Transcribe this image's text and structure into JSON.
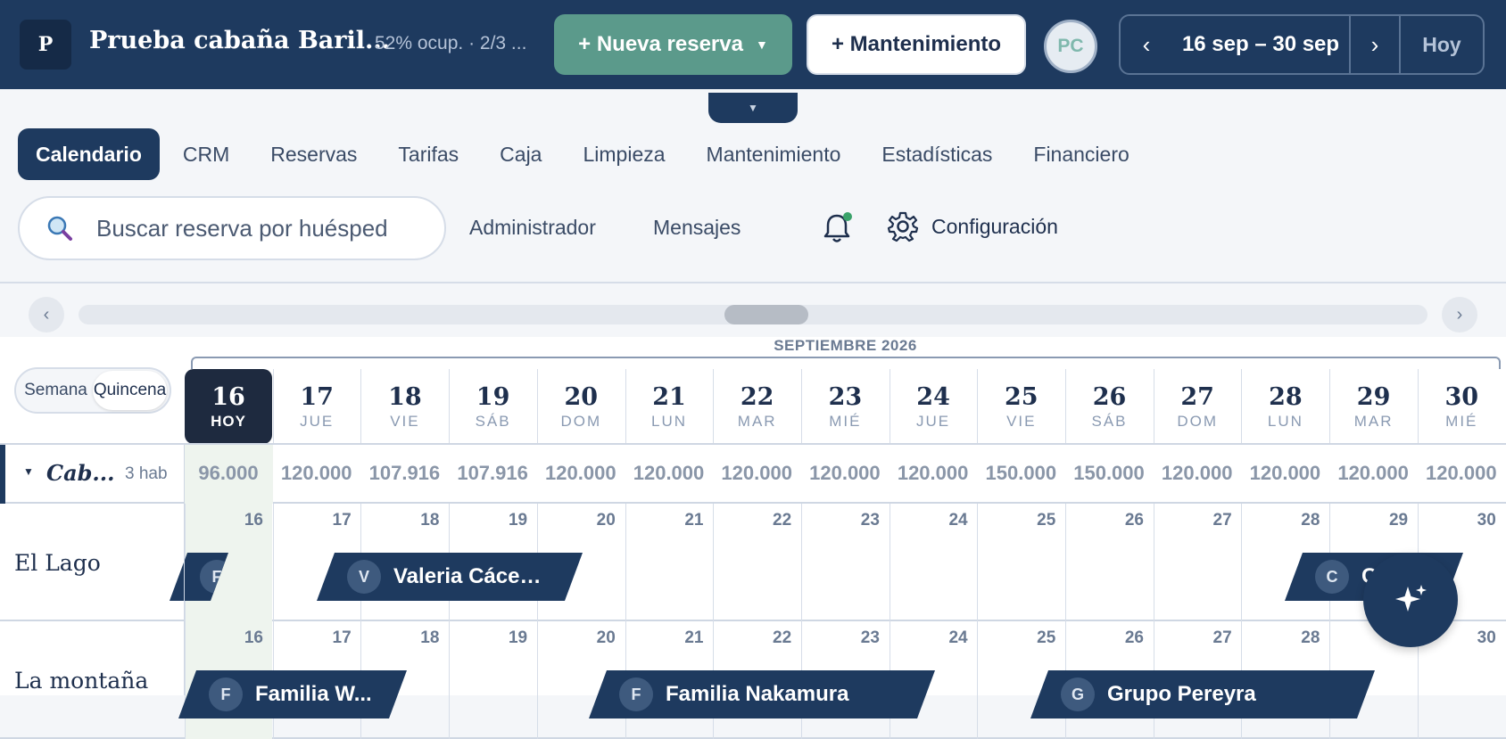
{
  "header": {
    "logo_letter": "P",
    "property_title": "Prueba cabaña Baril...",
    "occupancy": "52% ocup. · 2/3 ...",
    "new_booking_label": "+ Nueva reserva",
    "maintenance_label": "+ Mantenimiento",
    "avatar_initials": "PC",
    "date_range": "16 sep – 30 sep",
    "today_label": "Hoy",
    "prev_icon": "chevron-left-icon",
    "next_icon": "chevron-right-icon"
  },
  "nav": {
    "items": [
      {
        "label": "Calendario",
        "active": true
      },
      {
        "label": "CRM"
      },
      {
        "label": "Reservas"
      },
      {
        "label": "Tarifas"
      },
      {
        "label": "Caja"
      },
      {
        "label": "Limpieza"
      },
      {
        "label": "Mantenimiento"
      },
      {
        "label": "Estadísticas"
      },
      {
        "label": "Financiero"
      }
    ]
  },
  "toolbar": {
    "search_placeholder": "Buscar reserva por huésped",
    "admin_label": "Administrador",
    "messages_label": "Mensajes",
    "config_label": "Configuración"
  },
  "calendar": {
    "month_label": "SEPTIEMBRE 2026",
    "view_options": [
      "Semana",
      "Quincena"
    ],
    "selected_view": "Quincena",
    "days": [
      {
        "num": "16",
        "dow": "HOY",
        "today": true
      },
      {
        "num": "17",
        "dow": "JUE"
      },
      {
        "num": "18",
        "dow": "VIE"
      },
      {
        "num": "19",
        "dow": "SÁB"
      },
      {
        "num": "20",
        "dow": "DOM"
      },
      {
        "num": "21",
        "dow": "LUN"
      },
      {
        "num": "22",
        "dow": "MAR"
      },
      {
        "num": "23",
        "dow": "MIÉ"
      },
      {
        "num": "24",
        "dow": "JUE"
      },
      {
        "num": "25",
        "dow": "VIE"
      },
      {
        "num": "26",
        "dow": "SÁB"
      },
      {
        "num": "27",
        "dow": "DOM"
      },
      {
        "num": "28",
        "dow": "LUN"
      },
      {
        "num": "29",
        "dow": "MAR"
      },
      {
        "num": "30",
        "dow": "MIÉ"
      }
    ],
    "group": {
      "name": "Cab...",
      "count": "3 hab",
      "rates": [
        "96.000",
        "120.000",
        "107.916",
        "107.916",
        "120.000",
        "120.000",
        "120.000",
        "120.000",
        "120.000",
        "150.000",
        "150.000",
        "120.000",
        "120.000",
        "120.000",
        "120.000"
      ]
    },
    "rooms": [
      {
        "name": "El Lago",
        "bookings": [
          {
            "initial": "F",
            "label": ""
          },
          {
            "initial": "V",
            "label": "Valeria Cáce…"
          },
          {
            "initial": "C",
            "label": "C"
          }
        ]
      },
      {
        "name": "La montaña",
        "bookings": [
          {
            "initial": "F",
            "label": "Familia W..."
          },
          {
            "initial": "F",
            "label": "Familia Nakamura"
          },
          {
            "initial": "G",
            "label": "Grupo Pereyra"
          }
        ]
      }
    ]
  },
  "colors": {
    "primary": "#1e3a5f",
    "accent": "#5b9a8b",
    "today_bg": "#eef4ee"
  }
}
